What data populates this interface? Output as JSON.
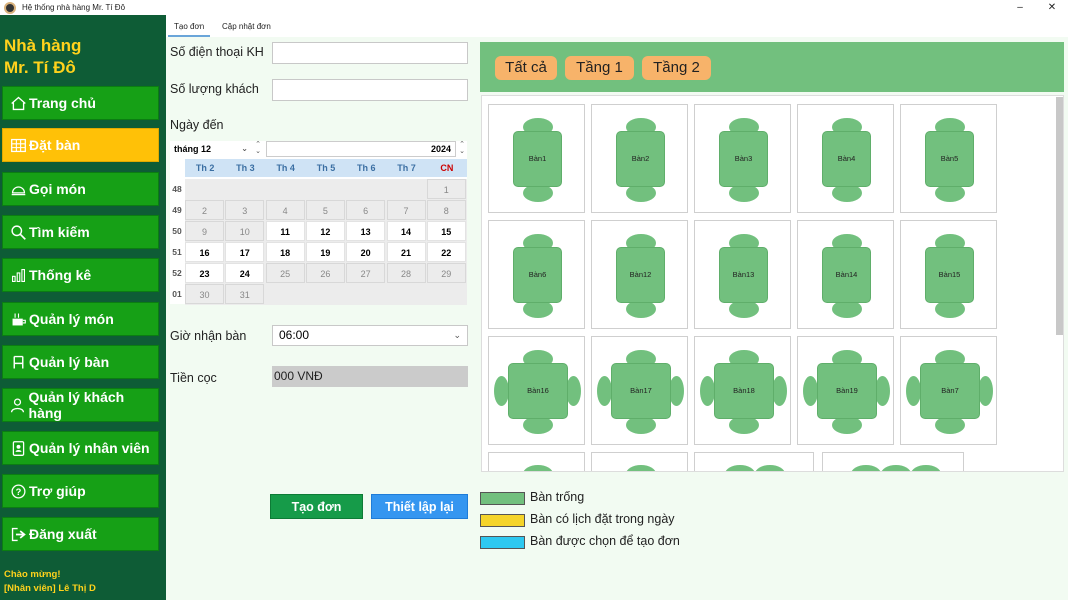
{
  "window": {
    "title": "Hệ thống nhà hàng Mr. Tí Đô",
    "minimize": "–",
    "close": "✕"
  },
  "sidebar": {
    "brand_line1": "Nhà hàng",
    "brand_line2": "Mr. Tí Đô",
    "items": [
      {
        "label": "Trang chủ",
        "icon": "home-icon",
        "active": false
      },
      {
        "label": "Đặt bàn",
        "icon": "table-grid-icon",
        "active": true
      },
      {
        "label": "Gọi món",
        "icon": "dish-cloche-icon",
        "active": false
      },
      {
        "label": "Tìm kiếm",
        "icon": "search-icon",
        "active": false
      },
      {
        "label": "Thống kê",
        "icon": "bar-chart-icon",
        "active": false
      },
      {
        "label": "Quản lý món",
        "icon": "food-icon",
        "active": false
      },
      {
        "label": "Quản lý bàn",
        "icon": "chair-icon",
        "active": false
      },
      {
        "label": "Quản lý khách hàng",
        "icon": "user-icon",
        "active": false
      },
      {
        "label": "Quản lý nhân viên",
        "icon": "id-badge-icon",
        "active": false
      },
      {
        "label": "Trợ giúp",
        "icon": "help-icon",
        "active": false
      },
      {
        "label": "Đăng xuất",
        "icon": "logout-icon",
        "active": false
      }
    ],
    "welcome": "Chào mừng!",
    "user": "[Nhân viên] Lê Thị D"
  },
  "tabs": [
    {
      "label": "Tạo đơn",
      "active": true
    },
    {
      "label": "Cập nhật đơn",
      "active": false
    }
  ],
  "form": {
    "phone_label": "Số điện thoại KH",
    "phone_value": "",
    "guests_label": "Số lượng khách",
    "guests_value": "",
    "date_label": "Ngày đến",
    "time_label": "Giờ nhận bàn",
    "time_value": "06:00",
    "deposit_label": "Tiền cọc",
    "deposit_value": "000 VNĐ"
  },
  "calendar": {
    "month": "tháng 12",
    "year": "2024",
    "weekdays": [
      "Th 2",
      "Th 3",
      "Th 4",
      "Th 5",
      "Th 6",
      "Th 7",
      "CN"
    ],
    "weeks": [
      {
        "num": "48",
        "days": [
          {
            "d": "",
            "e": false
          },
          {
            "d": "",
            "e": false
          },
          {
            "d": "",
            "e": false
          },
          {
            "d": "",
            "e": false
          },
          {
            "d": "",
            "e": false
          },
          {
            "d": "",
            "e": false
          },
          {
            "d": "1",
            "e": false
          }
        ]
      },
      {
        "num": "49",
        "days": [
          {
            "d": "2",
            "e": false
          },
          {
            "d": "3",
            "e": false
          },
          {
            "d": "4",
            "e": false
          },
          {
            "d": "5",
            "e": false
          },
          {
            "d": "6",
            "e": false
          },
          {
            "d": "7",
            "e": false
          },
          {
            "d": "8",
            "e": false
          }
        ]
      },
      {
        "num": "50",
        "days": [
          {
            "d": "9",
            "e": false
          },
          {
            "d": "10",
            "e": false
          },
          {
            "d": "11",
            "e": true
          },
          {
            "d": "12",
            "e": true
          },
          {
            "d": "13",
            "e": true
          },
          {
            "d": "14",
            "e": true
          },
          {
            "d": "15",
            "e": true
          }
        ]
      },
      {
        "num": "51",
        "days": [
          {
            "d": "16",
            "e": true
          },
          {
            "d": "17",
            "e": true
          },
          {
            "d": "18",
            "e": true
          },
          {
            "d": "19",
            "e": true
          },
          {
            "d": "20",
            "e": true
          },
          {
            "d": "21",
            "e": true
          },
          {
            "d": "22",
            "e": true
          }
        ]
      },
      {
        "num": "52",
        "days": [
          {
            "d": "23",
            "e": true
          },
          {
            "d": "24",
            "e": true
          },
          {
            "d": "25",
            "e": false
          },
          {
            "d": "26",
            "e": false
          },
          {
            "d": "27",
            "e": false
          },
          {
            "d": "28",
            "e": false
          },
          {
            "d": "29",
            "e": false
          }
        ]
      },
      {
        "num": "01",
        "days": [
          {
            "d": "30",
            "e": false
          },
          {
            "d": "31",
            "e": false
          }
        ]
      }
    ]
  },
  "buttons": {
    "create": "Tạo đơn",
    "reset": "Thiết lập lại"
  },
  "floors": [
    "Tất cả",
    "Tầng 1",
    "Tầng 2"
  ],
  "tables": [
    {
      "name": "Bàn1",
      "seats": 2
    },
    {
      "name": "Bàn2",
      "seats": 2
    },
    {
      "name": "Bàn3",
      "seats": 2
    },
    {
      "name": "Bàn4",
      "seats": 2
    },
    {
      "name": "Bàn5",
      "seats": 2
    },
    {
      "name": "Bàn6",
      "seats": 2
    },
    {
      "name": "Bàn12",
      "seats": 2
    },
    {
      "name": "Bàn13",
      "seats": 2
    },
    {
      "name": "Bàn14",
      "seats": 2
    },
    {
      "name": "Bàn15",
      "seats": 2
    },
    {
      "name": "Bàn16",
      "seats": 4
    },
    {
      "name": "Bàn17",
      "seats": 4
    },
    {
      "name": "Bàn18",
      "seats": 4
    },
    {
      "name": "Bàn19",
      "seats": 4
    },
    {
      "name": "Bàn7",
      "seats": 4
    }
  ],
  "legend": [
    {
      "label": "Bàn trống",
      "color": "#72c07e"
    },
    {
      "label": "Bàn có lịch đặt trong ngày",
      "color": "#f5d42a"
    },
    {
      "label": "Bàn được chọn để tạo đơn",
      "color": "#2ec8f0"
    }
  ],
  "colors": {
    "sidebar": "#0e5c36",
    "nav": "#16a016",
    "nav_active": "#ffc107",
    "brand_text": "#ffd21c",
    "table_green": "#72c07e"
  }
}
